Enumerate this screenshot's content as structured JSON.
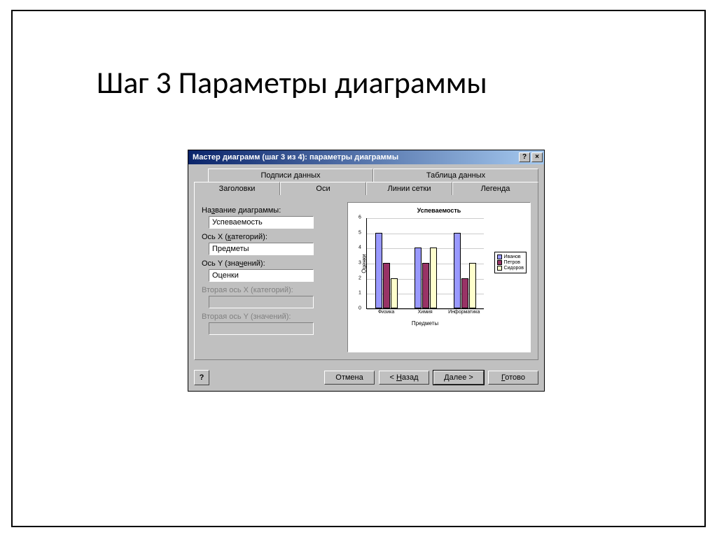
{
  "slide": {
    "title": "Шаг 3 Параметры диаграммы"
  },
  "dialog": {
    "title": "Мастер диаграмм (шаг 3 из 4): параметры диаграммы",
    "help_glyph": "?",
    "close_glyph": "×",
    "tabs_back": [
      "Подписи данных",
      "Таблица данных"
    ],
    "tabs_front": [
      "Заголовки",
      "Оси",
      "Линии сетки",
      "Легенда"
    ],
    "form": {
      "chart_title_label": "Название диаграммы:",
      "chart_title_value": "Успеваемость",
      "x_label": "Ось X (категорий):",
      "x_value": "Предметы",
      "y_label": "Ось Y (значений):",
      "y_value": "Оценки",
      "x2_label": "Вторая ось X (категорий):",
      "y2_label": "Вторая ось Y (значений):"
    },
    "buttons": {
      "help": "?",
      "cancel": "Отмена",
      "back": "< Назад",
      "next": "Далее >",
      "finish": "Готово"
    }
  },
  "chart_data": {
    "type": "bar",
    "title": "Успеваемость",
    "xlabel": "Предметы",
    "ylabel": "Оценки",
    "ylim": [
      0,
      6
    ],
    "yticks": [
      0,
      1,
      2,
      3,
      4,
      5,
      6
    ],
    "categories": [
      "Физика",
      "Химия",
      "Информатика"
    ],
    "series": [
      {
        "name": "Иванов",
        "color": "#9999ff",
        "values": [
          5,
          4,
          5
        ]
      },
      {
        "name": "Петров",
        "color": "#993366",
        "values": [
          3,
          3,
          2
        ]
      },
      {
        "name": "Сидоров",
        "color": "#ffffcc",
        "values": [
          2,
          4,
          3
        ]
      }
    ]
  }
}
